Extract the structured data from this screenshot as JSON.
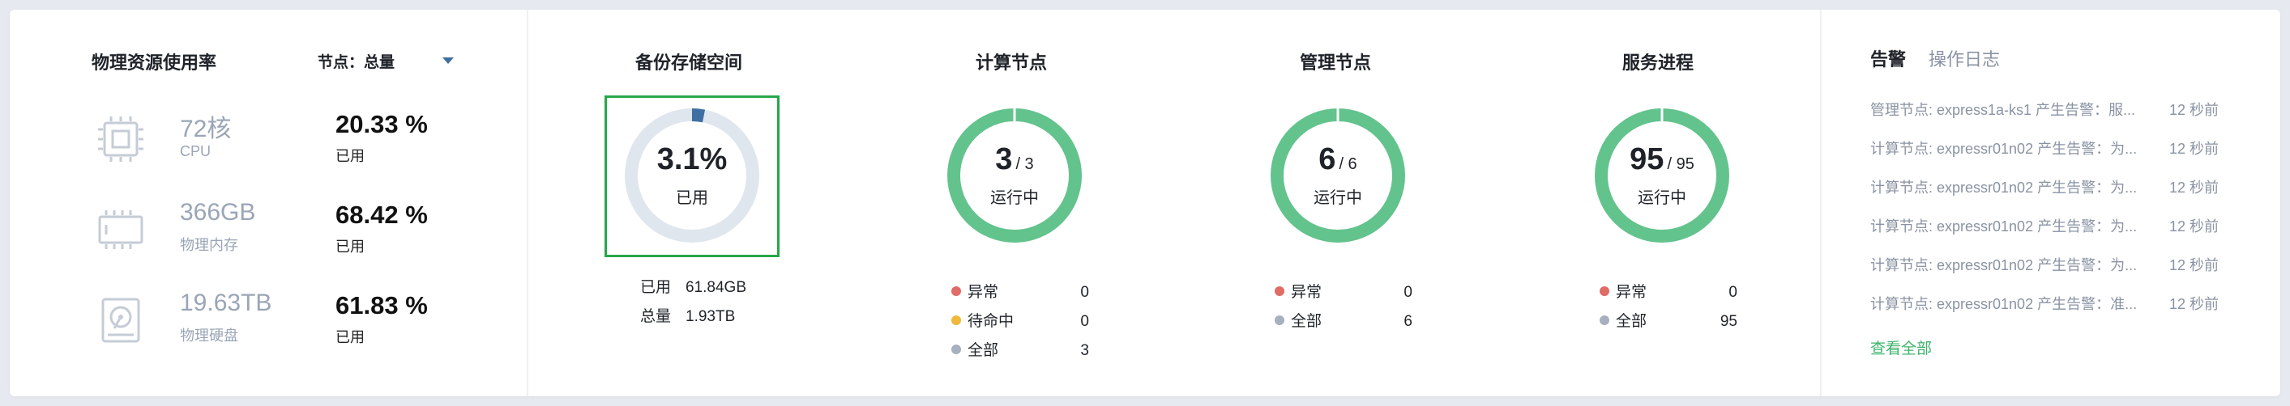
{
  "resource": {
    "title": "物理资源使用率",
    "node_filter_label": "节点：",
    "node_filter_value": "总量",
    "items": [
      {
        "value": "72核",
        "sub": "CPU",
        "percent": "20.33 %",
        "used": "已用",
        "icon": "cpu-icon"
      },
      {
        "value": "366GB",
        "sub": "物理内存",
        "percent": "68.42 %",
        "used": "已用",
        "icon": "memory-icon"
      },
      {
        "value": "19.63TB",
        "sub": "物理硬盘",
        "percent": "61.83 %",
        "used": "已用",
        "icon": "disk-icon"
      }
    ]
  },
  "backup": {
    "title": "备份存储空间",
    "percent_text": "3.1%",
    "percent_value": 3.1,
    "status": "已用",
    "used_label": "已用",
    "used_value": "61.84GB",
    "total_label": "总量",
    "total_value": "1.93TB"
  },
  "compute": {
    "title": "计算节点",
    "running": "3",
    "total": "/ 3",
    "status": "运行中",
    "legend": [
      {
        "label": "异常",
        "value": "0",
        "color": "#e06c65"
      },
      {
        "label": "待命中",
        "value": "0",
        "color": "#f0b93a"
      },
      {
        "label": "全部",
        "value": "3",
        "color": "#a6b0bf"
      }
    ]
  },
  "management": {
    "title": "管理节点",
    "running": "6",
    "total": "/ 6",
    "status": "运行中",
    "legend": [
      {
        "label": "异常",
        "value": "0",
        "color": "#e06c65"
      },
      {
        "label": "全部",
        "value": "6",
        "color": "#a6b0bf"
      }
    ]
  },
  "service": {
    "title": "服务进程",
    "running": "95",
    "total": "/ 95",
    "status": "运行中",
    "legend": [
      {
        "label": "异常",
        "value": "0",
        "color": "#e06c65"
      },
      {
        "label": "全部",
        "value": "95",
        "color": "#a6b0bf"
      }
    ]
  },
  "alerts": {
    "tab_alerts": "告警",
    "tab_logs": "操作日志",
    "items": [
      {
        "text": "管理节点: express1a-ks1 产生告警：服...",
        "time": "12 秒前"
      },
      {
        "text": "计算节点: expressr01n02 产生告警：为...",
        "time": "12 秒前"
      },
      {
        "text": "计算节点: expressr01n02 产生告警：为...",
        "time": "12 秒前"
      },
      {
        "text": "计算节点: expressr01n02 产生告警：为...",
        "time": "12 秒前"
      },
      {
        "text": "计算节点: expressr01n02 产生告警：为...",
        "time": "12 秒前"
      },
      {
        "text": "计算节点: expressr01n02 产生告警：准...",
        "time": "12 秒前"
      }
    ],
    "view_all": "查看全部"
  },
  "colors": {
    "ring_green": "#63c38d",
    "ring_track": "#dfe6ee",
    "ring_blue": "#3f6ea2",
    "highlight_border": "#27a74a",
    "link_green": "#3bb36b"
  }
}
